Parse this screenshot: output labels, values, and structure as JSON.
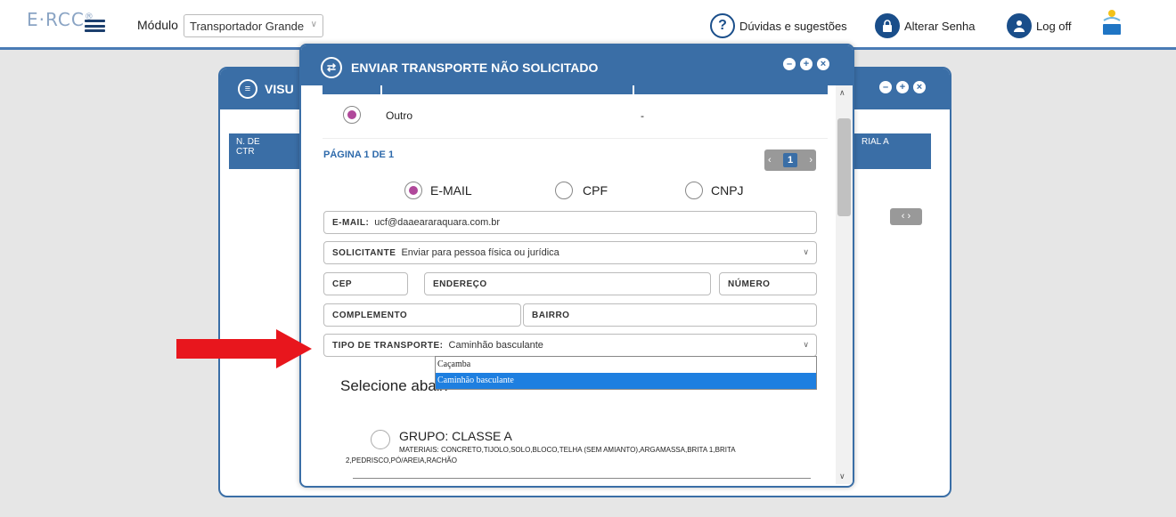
{
  "topbar": {
    "logo": "E·RCC",
    "modulo_label": "Módulo",
    "modulo_value": "Transportador Grande",
    "duvidas": "Dúvidas e sugestões",
    "alterar_senha": "Alterar Senha",
    "logoff": "Log off"
  },
  "background_panel": {
    "title": "VISU",
    "col1": "N. DE\nCTR",
    "col2": "RIAL A"
  },
  "modal": {
    "title": "ENVIAR TRANSPORTE NÃO SOLICITADO",
    "outro_label": "Outro",
    "outro_value": "-",
    "page_label": "PÁGINA 1 DE 1",
    "page_number": "1",
    "radio_email": "E-MAIL",
    "radio_cpf": "CPF",
    "radio_cnpj": "CNPJ",
    "email_label": "E-MAIL:",
    "email_value": "ucf@daaeararaquara.com.br",
    "solicitante_label": "SOLICITANTE",
    "solicitante_value": "Enviar para pessoa física ou jurídica",
    "cep_label": "CEP",
    "endereco_label": "ENDEREÇO",
    "numero_label": "NÚMERO",
    "complemento_label": "COMPLEMENTO",
    "bairro_label": "BAIRRO",
    "tipo_label": "TIPO DE TRANSPORTE:",
    "tipo_value": "Caminhão basculante",
    "tipo_options": [
      "Caçamba",
      "Caminhão basculante"
    ],
    "selecione_text": "Selecione abaix",
    "grupo_title": "GRUPO: CLASSE A",
    "grupo_materials_prefix": "MATERIAIS:",
    "grupo_materials": "CONCRETO,TIJOLO,SOLO,BLOCO,TELHA (SEM AMIANTO),ARGAMASSA,BRITA 1,BRITA 2,PEDRISCO,PÓ/AREIA,RACHÃO"
  },
  "colors": {
    "primary": "#3a6ea6",
    "radio_selected": "#b0489a",
    "dropdown_highlight": "#1e7fe0",
    "arrow": "#e8161d"
  },
  "icons": [
    "hamburger-icon",
    "question-icon",
    "lock-icon",
    "user-icon",
    "daae-logo",
    "transport-icon",
    "minimize-icon",
    "maximize-icon",
    "close-icon",
    "red-arrow"
  ]
}
